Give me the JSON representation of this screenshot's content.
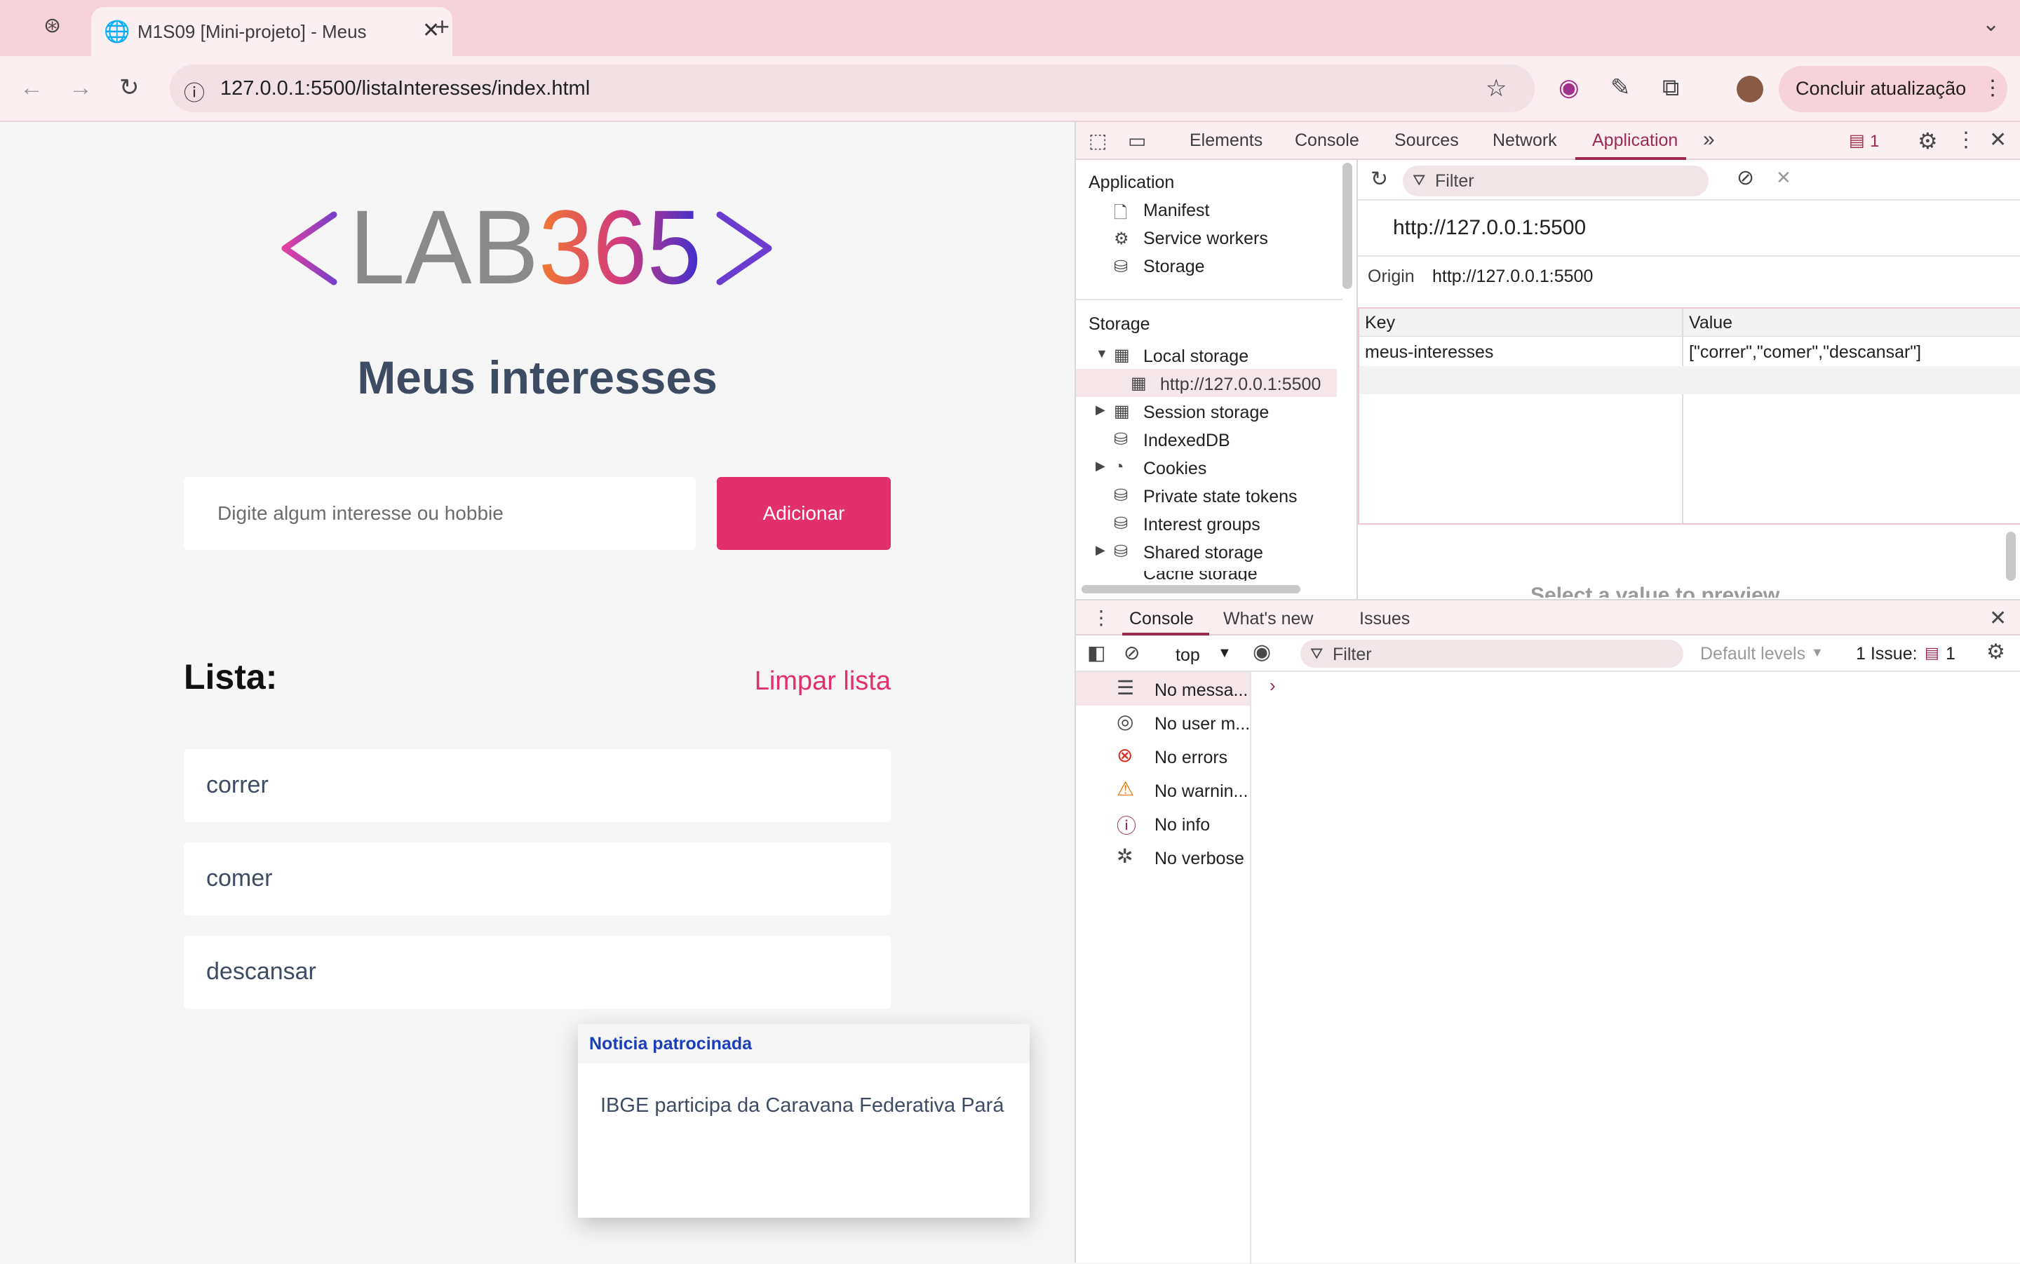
{
  "browser": {
    "tab_title": "M1S09 [Mini-projeto] - Meus",
    "url": "127.0.0.1:5500/listaInteresses/index.html",
    "update_label": "Concluir atualização"
  },
  "page": {
    "logo_text_gray": "LAB",
    "logo_text_color": "365",
    "title": "Meus interesses",
    "input_placeholder": "Digite algum interesse ou hobbie",
    "add_button": "Adicionar",
    "list_heading": "Lista:",
    "clear_list": "Limpar lista",
    "items": [
      "correr",
      "comer",
      "descansar"
    ],
    "ad": {
      "header": "Noticia patrocinada",
      "text": "IBGE participa da Caravana Federativa Pará"
    },
    "colors": {
      "accent": "#e1306c",
      "title": "#3e4c63"
    }
  },
  "devtools": {
    "tabs": [
      "Elements",
      "Console",
      "Sources",
      "Network",
      "Application"
    ],
    "issues_count": "1",
    "sidebar": {
      "application_header": "Application",
      "manifest": "Manifest",
      "service_workers": "Service workers",
      "storage_item": "Storage",
      "storage_header": "Storage",
      "local_storage": "Local storage",
      "local_origin": "http://127.0.0.1:5500",
      "session_storage": "Session storage",
      "indexeddb": "IndexedDB",
      "cookies": "Cookies",
      "private_state_tokens": "Private state tokens",
      "interest_groups": "Interest groups",
      "shared_storage": "Shared storage",
      "cache_storage": "Cache storage"
    },
    "main": {
      "filter_placeholder": "Filter",
      "origin_title": "http://127.0.0.1:5500",
      "origin_label": "Origin",
      "origin_value": "http://127.0.0.1:5500",
      "key_header": "Key",
      "value_header": "Value",
      "row_key": "meus-interesses",
      "row_value": "[\"correr\",\"comer\",\"descansar\"]",
      "preview": "Select a value to preview"
    },
    "drawer": {
      "tabs": [
        "Console",
        "What's new",
        "Issues"
      ],
      "context": "top",
      "filter_placeholder": "Filter",
      "levels": "Default levels",
      "issues_label": "1 Issue:",
      "issues_count": "1",
      "side_items": [
        "No messa...",
        "No user m...",
        "No errors",
        "No warnin...",
        "No info",
        "No verbose"
      ]
    }
  }
}
